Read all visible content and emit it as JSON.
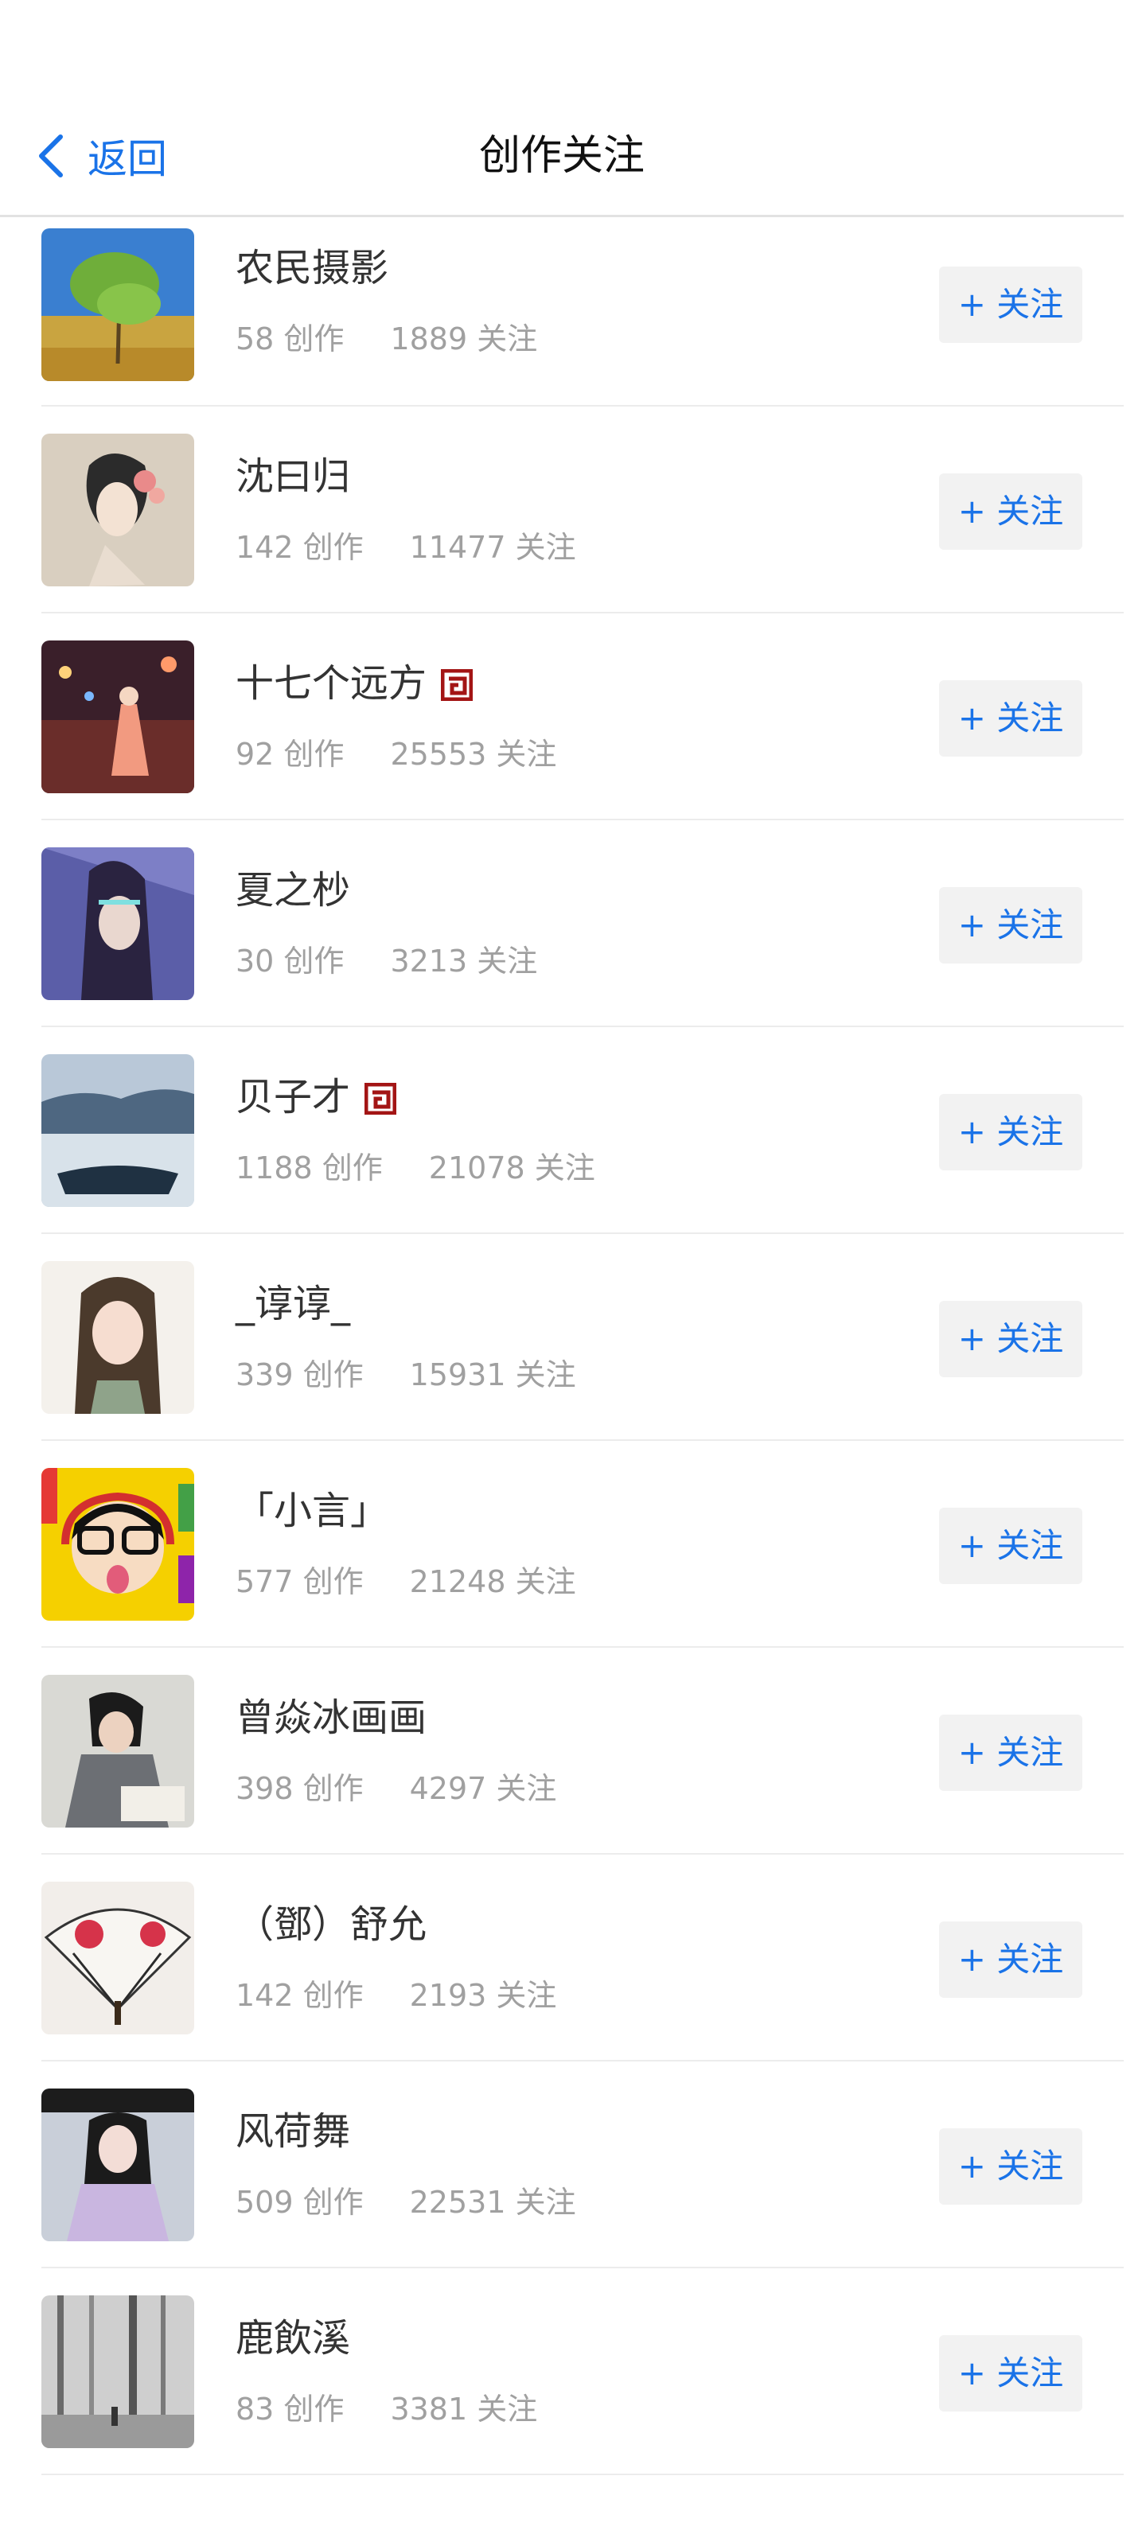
{
  "header": {
    "back_label": "返回",
    "title": "创作关注"
  },
  "follow_label": "+ 关注",
  "accent_color": "#1a73e8",
  "users": [
    {
      "name": "农民摄影",
      "works": "58 创作",
      "followers": "1889 关注",
      "verified": false
    },
    {
      "name": "沈曰归",
      "works": "142 创作",
      "followers": "11477 关注",
      "verified": false
    },
    {
      "name": "十七个远方",
      "works": "92 创作",
      "followers": "25553 关注",
      "verified": true
    },
    {
      "name": "夏之杪",
      "works": "30 创作",
      "followers": "3213 关注",
      "verified": false
    },
    {
      "name": "贝子才",
      "works": "1188 创作",
      "followers": "21078 关注",
      "verified": true
    },
    {
      "name": "_谆谆_",
      "works": "339 创作",
      "followers": "15931 关注",
      "verified": false
    },
    {
      "name": "「小言」",
      "works": "577 创作",
      "followers": "21248 关注",
      "verified": false
    },
    {
      "name": "曾焱冰画画",
      "works": "398 创作",
      "followers": "4297 关注",
      "verified": false
    },
    {
      "name": "（鄧）舒允",
      "works": "142 创作",
      "followers": "2193 关注",
      "verified": false
    },
    {
      "name": "风荷舞",
      "works": "509 创作",
      "followers": "22531 关注",
      "verified": false
    },
    {
      "name": "鹿飲溪",
      "works": "83 创作",
      "followers": "3381 关注",
      "verified": false
    }
  ]
}
